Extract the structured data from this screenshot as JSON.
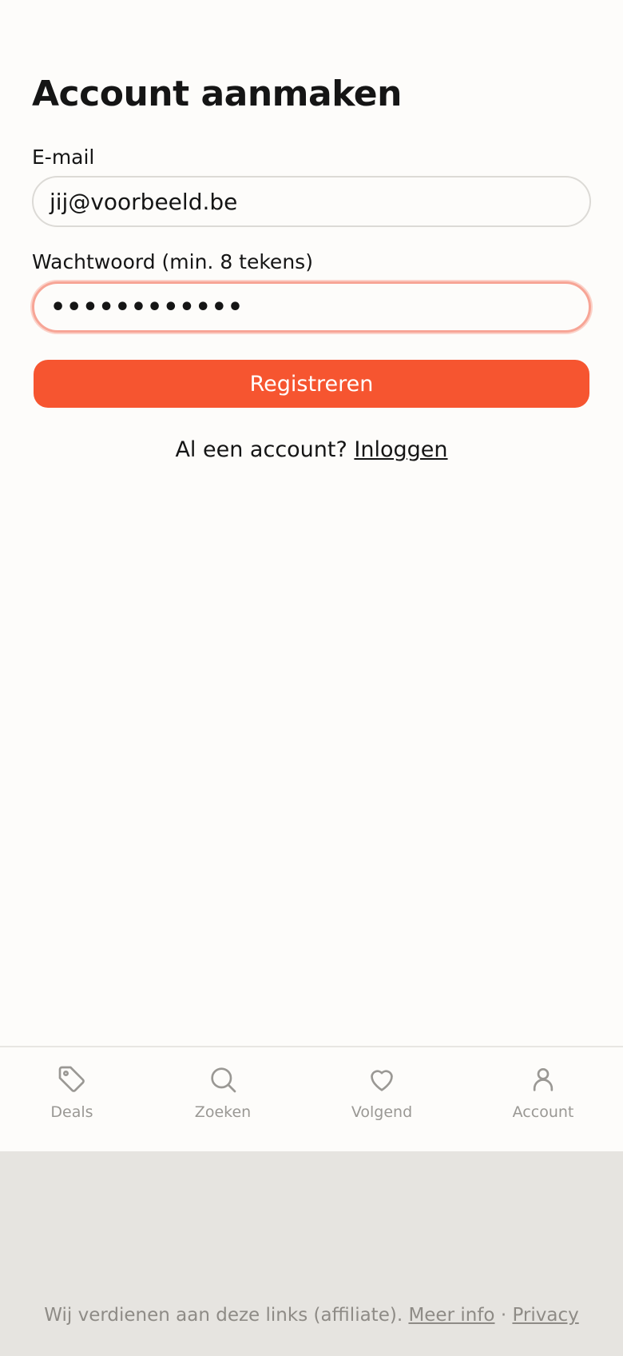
{
  "page": {
    "title": "Account aanmaken"
  },
  "form": {
    "email_label": "E-mail",
    "email_value": "jij@voorbeeld.be",
    "password_label": "Wachtwoord (min. 8 tekens)",
    "password_value": "••••••••••••",
    "submit_label": "Registreren",
    "login_prompt": "Al een account?",
    "login_link": "Inloggen"
  },
  "bottom_nav": {
    "items": [
      {
        "label": "Deals",
        "icon": "tag-icon"
      },
      {
        "label": "Zoeken",
        "icon": "search-icon"
      },
      {
        "label": "Volgend",
        "icon": "heart-icon"
      },
      {
        "label": "Account",
        "icon": "user-icon"
      }
    ]
  },
  "footer": {
    "note": "Wij verdienen aan deze links (affiliate).",
    "more_info": "Meer info",
    "separator": "·",
    "privacy": "Privacy"
  },
  "colors": {
    "accent": "#f65530",
    "focus_ring": "#f7a596",
    "background": "#fdfcfa",
    "footer_background": "#e6e4e0",
    "muted": "#9a9894"
  }
}
